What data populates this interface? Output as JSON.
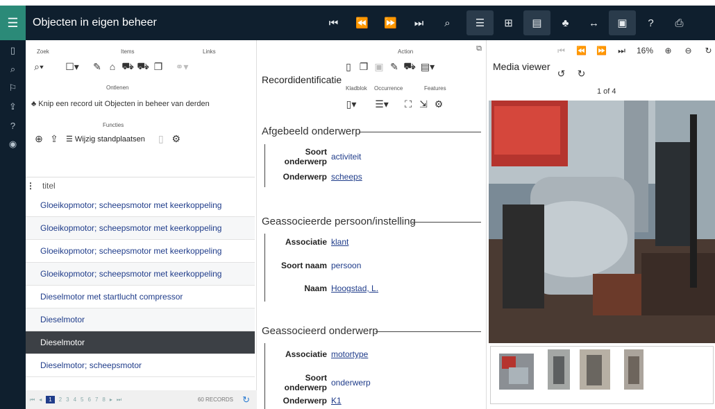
{
  "app": {
    "title": "Objecten in eigen beheer"
  },
  "toolbar": {
    "nav": [
      "first",
      "prev",
      "next",
      "last",
      "search"
    ],
    "views": [
      "list",
      "grid",
      "record",
      "tree",
      "expand",
      "film",
      "help",
      "print"
    ]
  },
  "left_panel": {
    "groups": {
      "zoek": "Zoek",
      "items": "Items",
      "links": "Links",
      "ontlenen": "Ontlenen",
      "functies": "Functies"
    },
    "cut_button": "Knip een record uit Objecten in beheer van derden",
    "change_button": "Wijzig standplaatsen",
    "list_header": "titel",
    "rows": [
      "Gloeikopmotor; scheepsmotor met keerkoppeling",
      "Gloeikopmotor; scheepsmotor met keerkoppeling",
      "Gloeikopmotor; scheepsmotor met keerkoppeling",
      "Gloeikopmotor; scheepsmotor met keerkoppeling",
      "Dieselmotor met startlucht compressor",
      "Dieselmotor",
      "Dieselmotor",
      "Dieselmotor; scheepsmotor"
    ],
    "pager": {
      "current": "1",
      "pages": [
        "2",
        "3",
        "4",
        "5",
        "6",
        "7",
        "8"
      ],
      "records": "60 RECORDS"
    }
  },
  "record_panel": {
    "title": "Recordidentificatie",
    "groups": {
      "action": "Action",
      "kladblok": "Kladblok",
      "occurrence": "Occurrence",
      "features": "Features"
    },
    "sections": [
      {
        "title": "Afgebeeld onderwerp",
        "fields": [
          {
            "label": "Soort onderwerp",
            "value": "activiteit"
          },
          {
            "label": "Onderwerp",
            "value": "scheeps"
          }
        ]
      },
      {
        "title": "Geassocieerde persoon/instelling",
        "fields": [
          {
            "label": "Associatie",
            "value": "klant"
          },
          {
            "label": "Soort naam",
            "value": "persoon"
          },
          {
            "label": "Naam",
            "value": "Hoogstad, L."
          }
        ]
      },
      {
        "title": "Geassocieerd onderwerp",
        "fields": [
          {
            "label": "Associatie",
            "value": "motortype"
          },
          {
            "label": "Soort onderwerp",
            "value": "onderwerp"
          },
          {
            "label": "Onderwerp",
            "value": "K1"
          }
        ]
      }
    ]
  },
  "media": {
    "title": "Media viewer",
    "zoom": "16%",
    "page": "1 of 4"
  }
}
